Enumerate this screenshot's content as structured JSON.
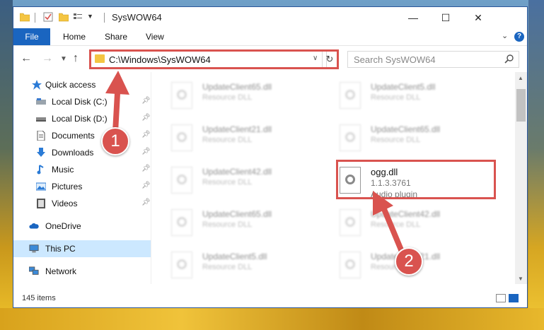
{
  "window": {
    "title": "SysWOW64"
  },
  "menu": {
    "file": "File",
    "home": "Home",
    "share": "Share",
    "view": "View",
    "help": "?"
  },
  "nav": {
    "address": "C:\\Windows\\SysWOW64",
    "search_placeholder": "Search SysWOW64"
  },
  "sidebar": {
    "items": [
      {
        "label": "Quick access"
      },
      {
        "label": "Local Disk (C:)"
      },
      {
        "label": "Local Disk (D:)"
      },
      {
        "label": "Documents"
      },
      {
        "label": "Downloads"
      },
      {
        "label": "Music"
      },
      {
        "label": "Pictures"
      },
      {
        "label": "Videos"
      },
      {
        "label": "OneDrive"
      },
      {
        "label": "This PC"
      },
      {
        "label": "Network"
      }
    ]
  },
  "files": {
    "left": [
      {
        "name": "UpdateClient65.dll",
        "desc": "Resource DLL"
      },
      {
        "name": "UpdateClient21.dll",
        "desc": "Resource DLL"
      },
      {
        "name": "UpdateClient42.dll",
        "desc": "Resource DLL"
      },
      {
        "name": "UpdateClient65.dll",
        "desc": "Resource DLL"
      },
      {
        "name": "UpdateClient5.dll",
        "desc": "Resource DLL"
      }
    ],
    "right": [
      {
        "name": "UpdateClient5.dll",
        "desc": "Resource DLL"
      },
      {
        "name": "UpdateClient65.dll",
        "desc": "Resource DLL"
      },
      {
        "name": "UpdateClient42.dll",
        "desc": "Resource DLL"
      },
      {
        "name": "UpdateClient21.dll",
        "desc": "Resource DLL"
      }
    ],
    "ogg": {
      "name": "ogg.dll",
      "version": "1.1.3.3761",
      "desc": "Audio plugin"
    }
  },
  "status": {
    "items": "145 items"
  },
  "annotations": {
    "step1": "1",
    "step2": "2"
  },
  "colors": {
    "accent": "#1a65c0",
    "highlight": "#d9534f",
    "selected": "#cce8ff"
  }
}
